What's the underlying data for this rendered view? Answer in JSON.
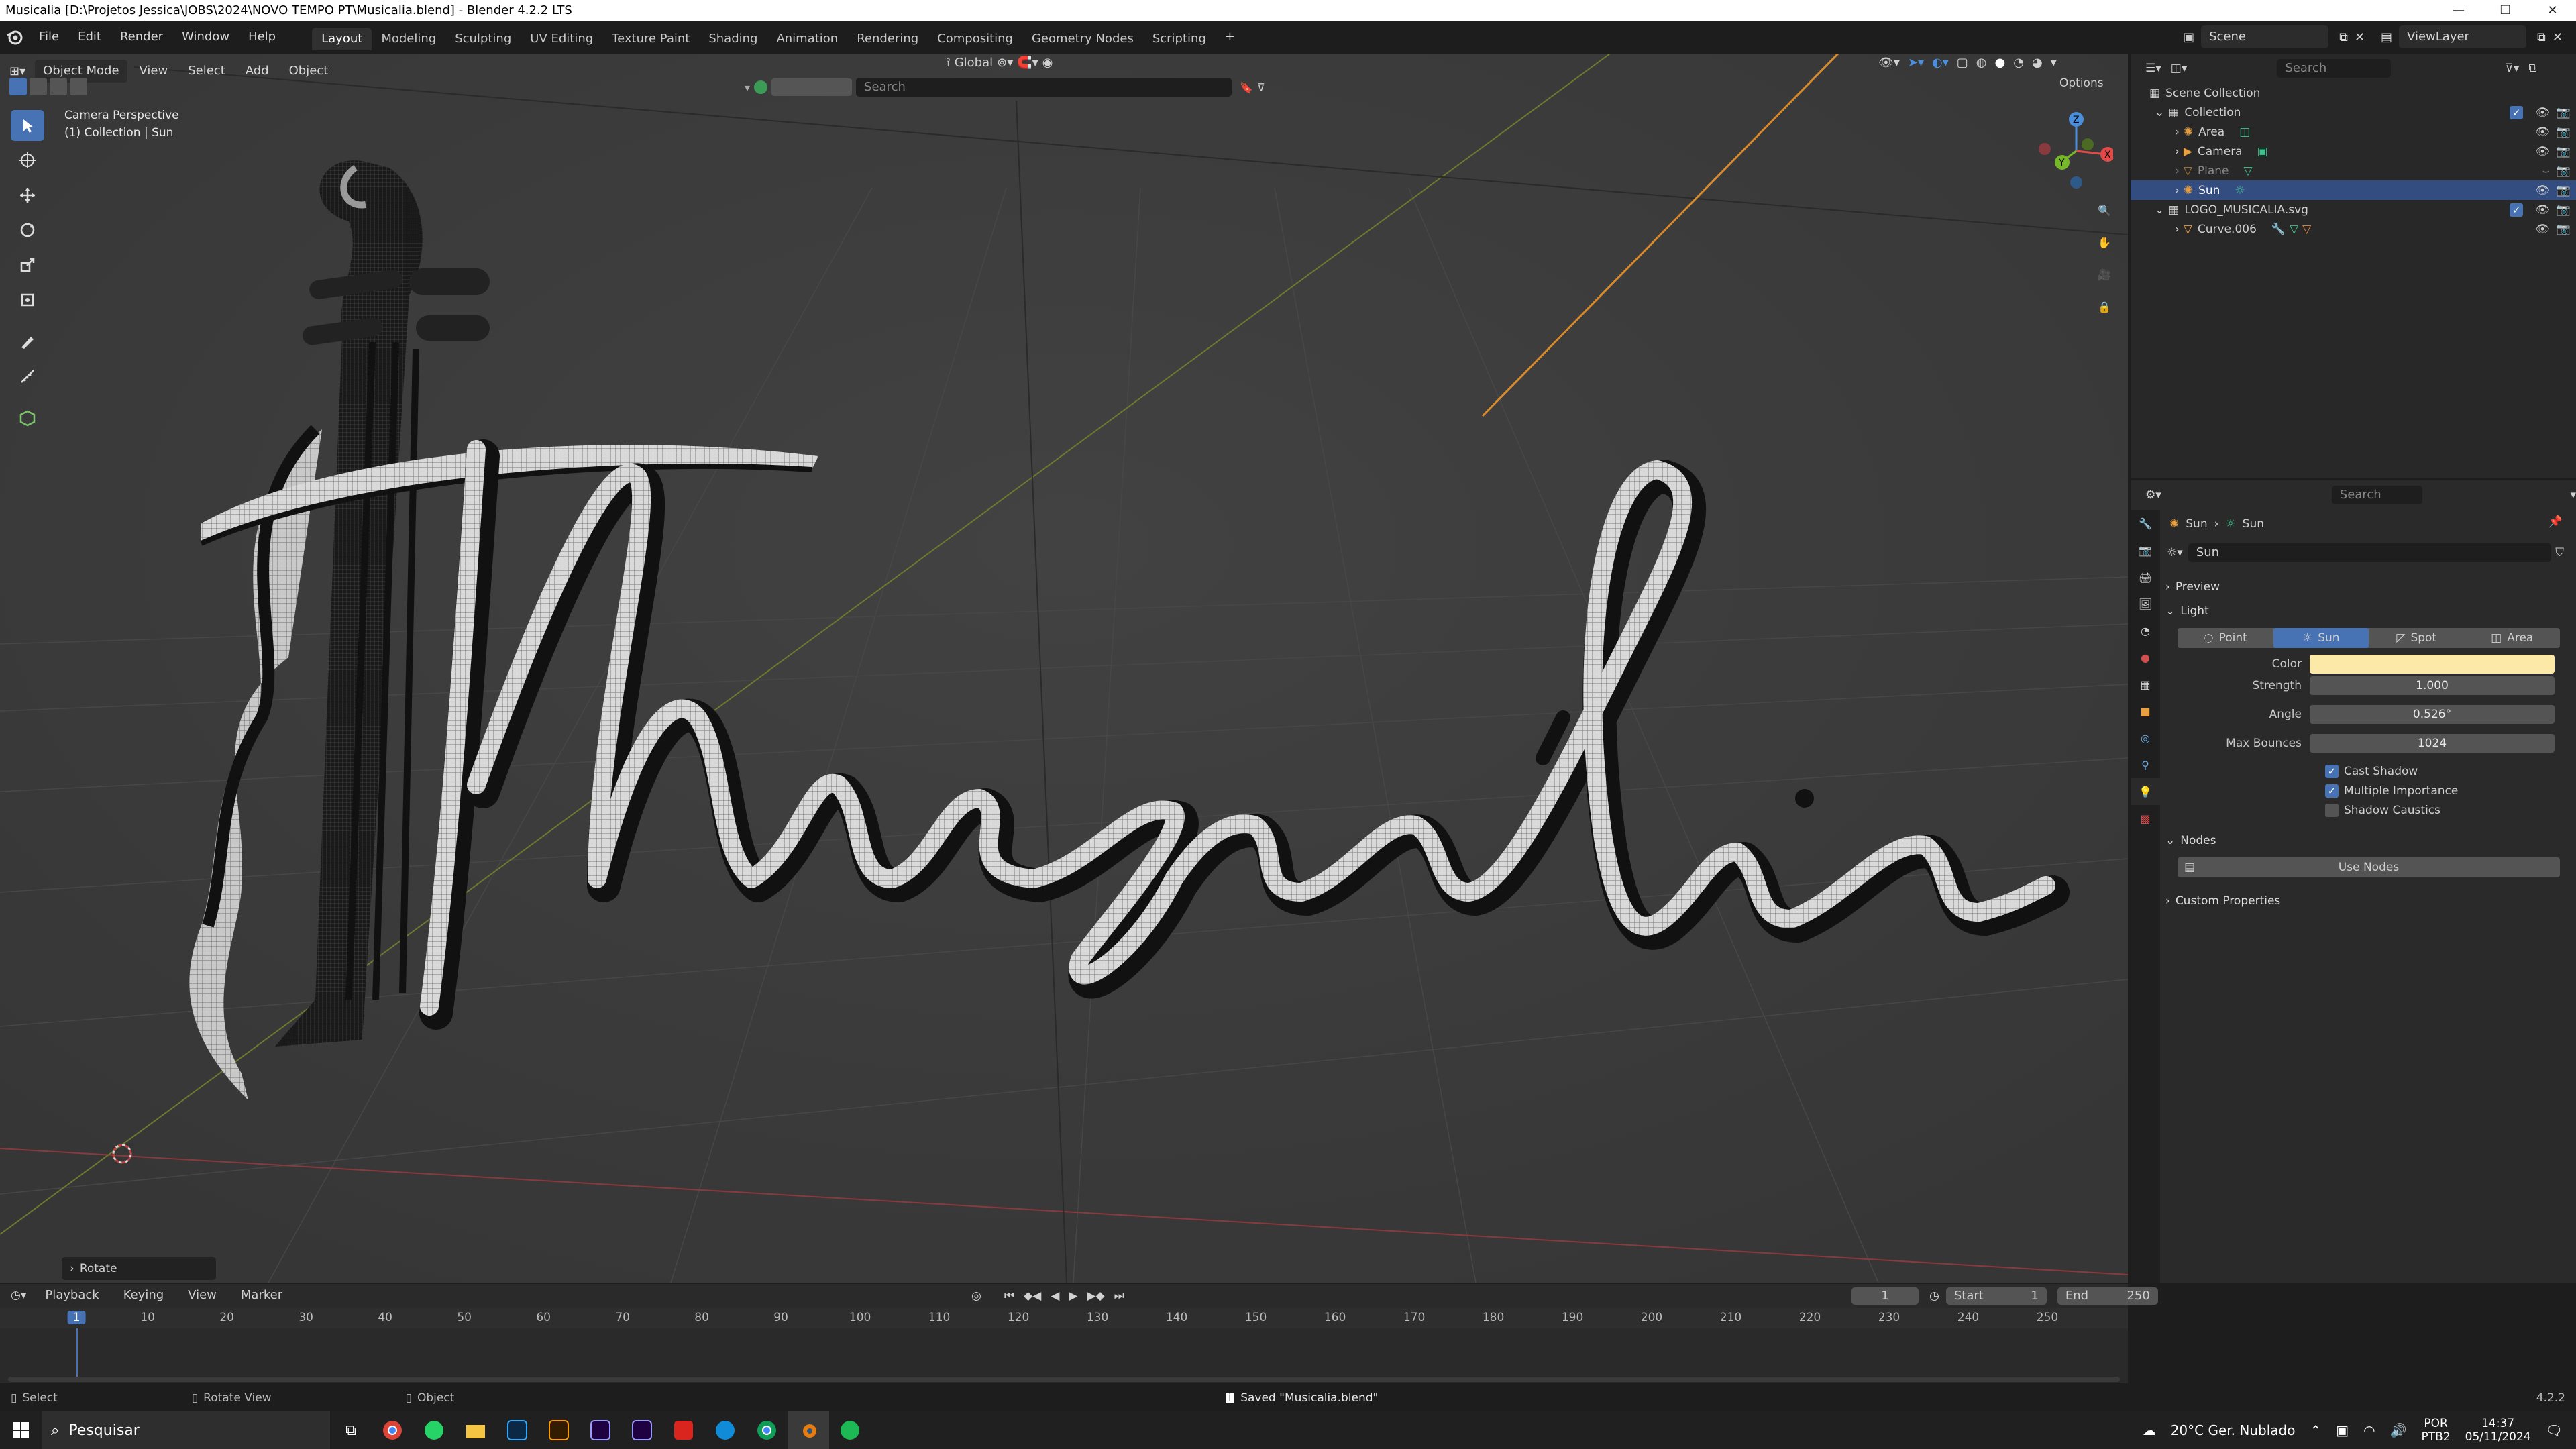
{
  "window": {
    "title": "Musicalia [D:\\Projetos Jessica\\JOBS\\2024\\NOVO TEMPO PT\\Musicalia.blend] - Blender 4.2.2 LTS"
  },
  "menu": [
    "File",
    "Edit",
    "Render",
    "Window",
    "Help"
  ],
  "workspaces": [
    "Layout",
    "Modeling",
    "Sculpting",
    "UV Editing",
    "Texture Paint",
    "Shading",
    "Animation",
    "Rendering",
    "Compositing",
    "Geometry Nodes",
    "Scripting"
  ],
  "active_workspace": "Layout",
  "scene": {
    "name": "Scene",
    "view_layer": "ViewLayer",
    "search_placeholder": "Search"
  },
  "viewport": {
    "mode": "Object Mode",
    "menu": [
      "View",
      "Select",
      "Add",
      "Object"
    ],
    "orientation": "Global",
    "search_placeholder": "Search",
    "options_label": "Options",
    "overlay_title": "Camera Perspective",
    "overlay_subtitle": "(1) Collection | Sun",
    "logo_text": "Musicália",
    "last_operator": "Rotate",
    "gizmo": {
      "z": "Z",
      "y": "Y",
      "x": "X"
    }
  },
  "outliner": {
    "search_placeholder": "Search",
    "root": "Scene Collection",
    "items": [
      {
        "label": "Collection",
        "indent": 1
      },
      {
        "label": "Area",
        "indent": 2
      },
      {
        "label": "Camera",
        "indent": 2
      },
      {
        "label": "Plane",
        "indent": 2
      },
      {
        "label": "Sun",
        "indent": 2,
        "selected": true
      },
      {
        "label": "LOGO_MUSICALIA.svg",
        "indent": 1
      },
      {
        "label": "Curve.006",
        "indent": 2
      }
    ]
  },
  "properties": {
    "search_placeholder": "Search",
    "breadcrumb": [
      "Sun",
      "Sun"
    ],
    "datablock": "Sun",
    "panels": {
      "preview": "Preview",
      "light": "Light",
      "nodes": "Nodes",
      "custom": "Custom Properties"
    },
    "light_types": [
      "Point",
      "Sun",
      "Spot",
      "Area"
    ],
    "active_light_type": "Sun",
    "fields": [
      {
        "label": "Color",
        "value": ""
      },
      {
        "label": "Strength",
        "value": "1.000"
      },
      {
        "label": "Angle",
        "value": "0.526°"
      },
      {
        "label": "Max Bounces",
        "value": "1024"
      }
    ],
    "color_hex": "#fce9a8",
    "checks": [
      {
        "label": "Cast Shadow",
        "checked": true
      },
      {
        "label": "Multiple Importance",
        "checked": true
      },
      {
        "label": "Shadow Caustics",
        "checked": false
      }
    ],
    "use_nodes": "Use Nodes"
  },
  "timeline": {
    "menu": [
      "Playback",
      "Keying",
      "View",
      "Marker"
    ],
    "current_frame": "1",
    "start_label": "Start",
    "start": "1",
    "end_label": "End",
    "end": "250",
    "ticks": [
      "1",
      "10",
      "20",
      "30",
      "40",
      "50",
      "60",
      "70",
      "80",
      "90",
      "100",
      "110",
      "120",
      "130",
      "140",
      "150",
      "160",
      "170",
      "180",
      "190",
      "200",
      "210",
      "220",
      "230",
      "240",
      "250"
    ]
  },
  "statusbar": {
    "left": "Select",
    "mid": "Rotate View",
    "right": "Object",
    "message": "Saved \"Musicalia.blend\"",
    "version": "4.2.2"
  },
  "taskbar": {
    "search_placeholder": "Pesquisar",
    "weather": "20°C Ger. Nublado",
    "lang": "POR",
    "lang2": "PTB2",
    "time": "14:37",
    "date": "05/11/2024"
  }
}
